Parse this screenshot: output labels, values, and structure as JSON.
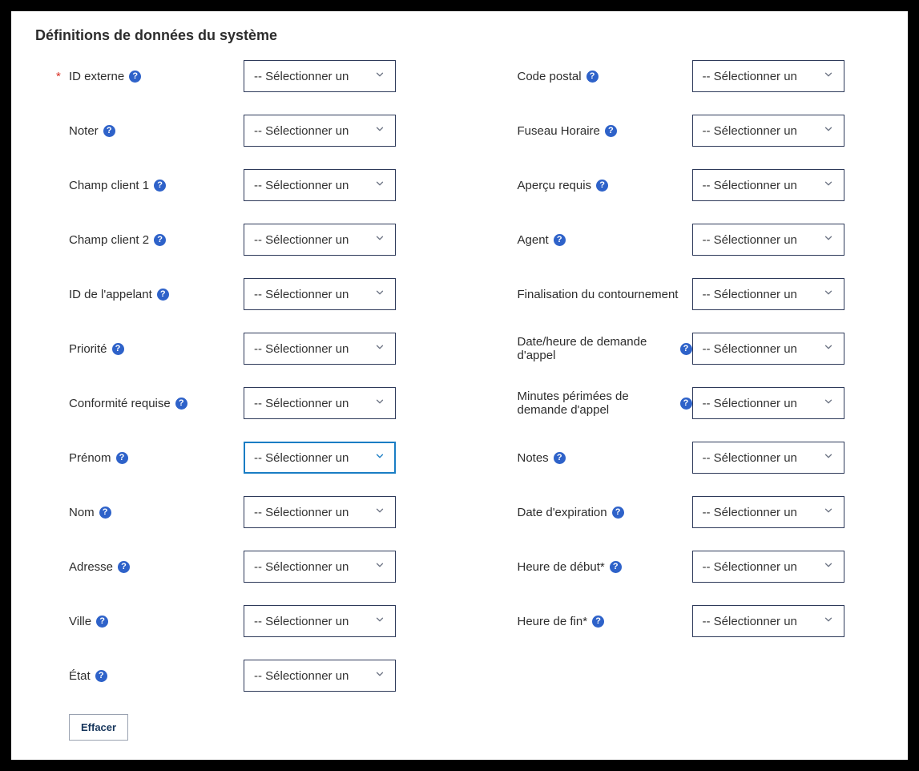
{
  "title": "Définitions de données du système",
  "selectPlaceholder": "-- Sélectionner un",
  "requiredMark": "*",
  "helpGlyph": "?",
  "clearLabel": "Effacer",
  "leftFields": [
    {
      "label": "ID externe",
      "required": true,
      "help": true,
      "focused": false
    },
    {
      "label": "Noter",
      "required": false,
      "help": true,
      "focused": false
    },
    {
      "label": "Champ client 1",
      "required": false,
      "help": true,
      "focused": false
    },
    {
      "label": "Champ client 2",
      "required": false,
      "help": true,
      "focused": false
    },
    {
      "label": "ID de l'appelant",
      "required": false,
      "help": true,
      "focused": false
    },
    {
      "label": "Priorité",
      "required": false,
      "help": true,
      "focused": false
    },
    {
      "label": "Conformité requise",
      "required": false,
      "help": true,
      "focused": false
    },
    {
      "label": "Prénom",
      "required": false,
      "help": true,
      "focused": true
    },
    {
      "label": "Nom",
      "required": false,
      "help": true,
      "focused": false
    },
    {
      "label": "Adresse",
      "required": false,
      "help": true,
      "focused": false
    },
    {
      "label": "Ville",
      "required": false,
      "help": true,
      "focused": false
    },
    {
      "label": "État",
      "required": false,
      "help": true,
      "focused": false
    }
  ],
  "rightFields": [
    {
      "label": "Code postal",
      "required": false,
      "help": true,
      "focused": false
    },
    {
      "label": "Fuseau Horaire",
      "required": false,
      "help": true,
      "focused": false
    },
    {
      "label": "Aperçu requis",
      "required": false,
      "help": true,
      "focused": false
    },
    {
      "label": "Agent",
      "required": false,
      "help": true,
      "focused": false
    },
    {
      "label": "Finalisation du contournement",
      "required": false,
      "help": false,
      "focused": false
    },
    {
      "label": "Date/heure de demande d'appel",
      "required": false,
      "help": true,
      "focused": false
    },
    {
      "label": "Minutes périmées de demande d'appel",
      "required": false,
      "help": true,
      "focused": false
    },
    {
      "label": "Notes",
      "required": false,
      "help": true,
      "focused": false
    },
    {
      "label": "Date d'expiration",
      "required": false,
      "help": true,
      "focused": false
    },
    {
      "label": "Heure de début*",
      "required": false,
      "help": true,
      "focused": false
    },
    {
      "label": "Heure de fin*",
      "required": false,
      "help": true,
      "focused": false
    }
  ]
}
